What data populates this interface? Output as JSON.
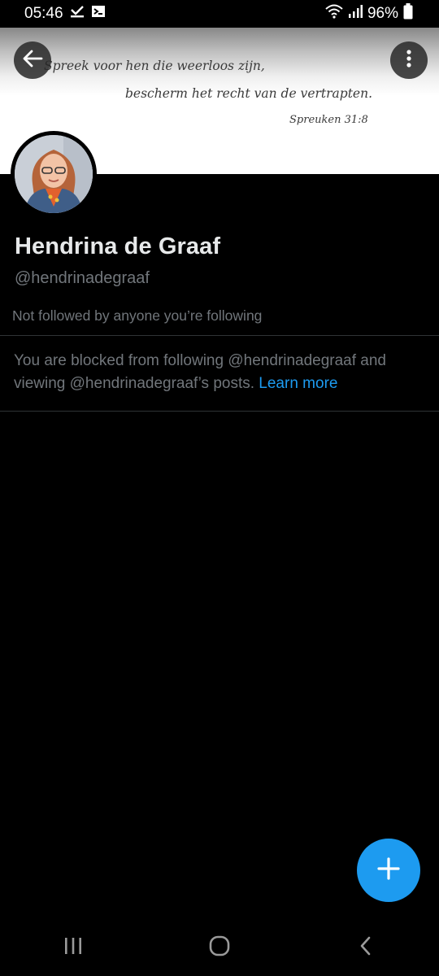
{
  "status_bar": {
    "time": "05:46",
    "battery_percent": "96%",
    "icons": [
      "check-download-icon",
      "terminal-icon",
      "wifi-icon",
      "signal-icon",
      "battery-icon"
    ]
  },
  "banner": {
    "quote_line_1": "Spreek voor hen die weerloos zijn,",
    "quote_line_2": "bescherm het recht van de vertrapten.",
    "quote_ref": "Spreuken 31:8"
  },
  "profile": {
    "display_name": "Hendrina de Graaf",
    "handle": "@hendrinadegraaf",
    "followed_by": "Not followed by anyone you’re following"
  },
  "blocked_notice": {
    "text": "You are blocked from following @hendrinadegraaf and viewing @hendrinadegraaf’s posts.",
    "link": "Learn more"
  },
  "colors": {
    "background": "#000000",
    "accent": "#1d9bf0",
    "primary_text": "#e7e9ea",
    "secondary_text": "#71767b",
    "divider": "#2f3336"
  },
  "fab": {
    "icon": "plus-icon"
  },
  "nav_bar": {
    "icons": [
      "recents-icon",
      "home-icon",
      "back-icon"
    ]
  }
}
